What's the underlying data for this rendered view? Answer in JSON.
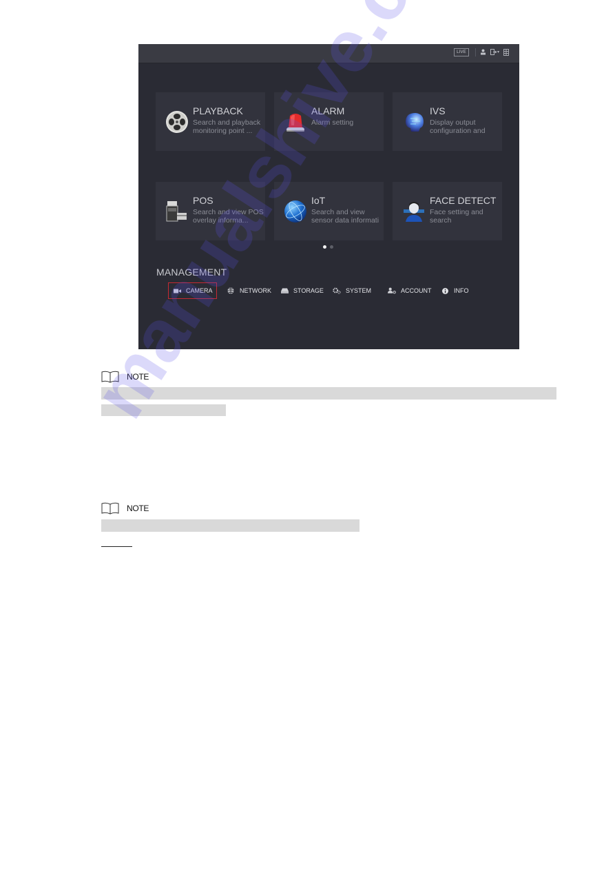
{
  "ui": {
    "topbar": {
      "live_label": "LIVE",
      "icons": [
        "user-icon",
        "logout-icon",
        "chevron-down-icon",
        "grid-menu-icon"
      ]
    },
    "tiles": [
      {
        "title": "PLAYBACK",
        "desc_line1": "Search and playback",
        "desc_line2": "monitoring point ...",
        "icon": "playback-reel-icon"
      },
      {
        "title": "ALARM",
        "desc_line1": "Alarm setting",
        "desc_line2": "",
        "icon": "alarm-siren-icon"
      },
      {
        "title": "IVS",
        "desc_line1": "Display output",
        "desc_line2": "configuration and",
        "icon": "ivs-head-icon"
      },
      {
        "title": "POS",
        "desc_line1": "Search and view POS",
        "desc_line2": "overlay informa...",
        "icon": "pos-terminal-icon"
      },
      {
        "title": "IoT",
        "desc_line1": "Search and view",
        "desc_line2": "sensor data informati",
        "icon": "iot-globe-icon"
      },
      {
        "title": "FACE DETECT",
        "desc_line1": "Face setting and",
        "desc_line2": "search",
        "icon": "face-detect-icon"
      }
    ],
    "pagination": {
      "current": 1,
      "total": 2
    },
    "management": {
      "title": "MANAGEMENT",
      "items": [
        {
          "label": "CAMERA",
          "icon": "camera-icon",
          "selected": true
        },
        {
          "label": "NETWORK",
          "icon": "network-globe-icon",
          "selected": false
        },
        {
          "label": "STORAGE",
          "icon": "storage-icon",
          "selected": false
        },
        {
          "label": "SYSTEM",
          "icon": "gears-icon",
          "selected": false
        },
        {
          "label": "ACCOUNT",
          "icon": "account-icon",
          "selected": false
        },
        {
          "label": "INFO",
          "icon": "info-icon",
          "selected": false
        }
      ]
    }
  },
  "notes": [
    {
      "label": "NOTE"
    },
    {
      "label": "NOTE"
    }
  ],
  "watermark": "manualshive.com",
  "colors": {
    "screen_bg": "#2a2b34",
    "tile_bg": "#32333d",
    "selection_border": "#c62a33",
    "redaction_bar": "#d9d9d9"
  }
}
